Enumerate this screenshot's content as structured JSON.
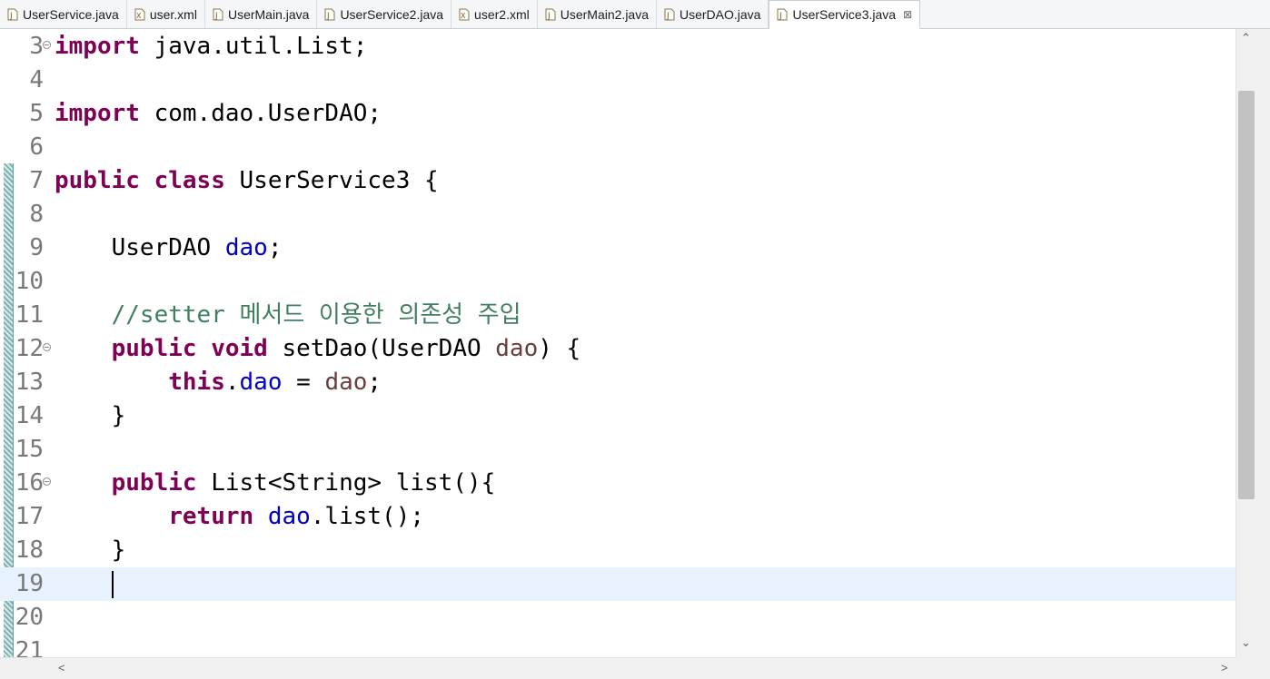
{
  "tabs": [
    {
      "label": "UserService.java",
      "type": "java",
      "active": false
    },
    {
      "label": "user.xml",
      "type": "xml",
      "active": false
    },
    {
      "label": "UserMain.java",
      "type": "java",
      "active": false
    },
    {
      "label": "UserService2.java",
      "type": "java",
      "active": false
    },
    {
      "label": "user2.xml",
      "type": "xml",
      "active": false
    },
    {
      "label": "UserMain2.java",
      "type": "java",
      "active": false
    },
    {
      "label": "UserDAO.java",
      "type": "java",
      "active": false
    },
    {
      "label": "UserService3.java",
      "type": "java",
      "active": true
    }
  ],
  "tab_close_glyph": "⊠",
  "editor": {
    "lines": [
      {
        "num": "3",
        "fold": true,
        "parts": [
          {
            "t": "import",
            "c": "kw"
          },
          {
            "t": " java.util.List;",
            "c": ""
          }
        ]
      },
      {
        "num": "4",
        "parts": []
      },
      {
        "num": "5",
        "parts": [
          {
            "t": "import",
            "c": "kw"
          },
          {
            "t": " com.dao.UserDAO;",
            "c": ""
          }
        ]
      },
      {
        "num": "6",
        "parts": []
      },
      {
        "num": "7",
        "parts": [
          {
            "t": "public",
            "c": "kw"
          },
          {
            "t": " ",
            "c": ""
          },
          {
            "t": "class",
            "c": "kw"
          },
          {
            "t": " UserService3 {",
            "c": ""
          }
        ]
      },
      {
        "num": "8",
        "parts": []
      },
      {
        "num": "9",
        "parts": [
          {
            "t": "    UserDAO ",
            "c": ""
          },
          {
            "t": "dao",
            "c": "fld"
          },
          {
            "t": ";",
            "c": ""
          }
        ]
      },
      {
        "num": "10",
        "parts": []
      },
      {
        "num": "11",
        "parts": [
          {
            "t": "    ",
            "c": ""
          },
          {
            "t": "//setter 메서드 이용한 의존성 주입",
            "c": "cmt"
          }
        ]
      },
      {
        "num": "12",
        "fold": true,
        "parts": [
          {
            "t": "    ",
            "c": ""
          },
          {
            "t": "public",
            "c": "kw"
          },
          {
            "t": " ",
            "c": ""
          },
          {
            "t": "void",
            "c": "kw"
          },
          {
            "t": " setDao(UserDAO ",
            "c": ""
          },
          {
            "t": "dao",
            "c": "param"
          },
          {
            "t": ") {",
            "c": ""
          }
        ]
      },
      {
        "num": "13",
        "parts": [
          {
            "t": "        ",
            "c": ""
          },
          {
            "t": "this",
            "c": "kw"
          },
          {
            "t": ".",
            "c": ""
          },
          {
            "t": "dao",
            "c": "fld"
          },
          {
            "t": " = ",
            "c": ""
          },
          {
            "t": "dao",
            "c": "param"
          },
          {
            "t": ";",
            "c": ""
          }
        ]
      },
      {
        "num": "14",
        "parts": [
          {
            "t": "    }",
            "c": ""
          }
        ]
      },
      {
        "num": "15",
        "parts": []
      },
      {
        "num": "16",
        "fold": true,
        "parts": [
          {
            "t": "    ",
            "c": ""
          },
          {
            "t": "public",
            "c": "kw"
          },
          {
            "t": " List<String> list(){",
            "c": ""
          }
        ]
      },
      {
        "num": "17",
        "parts": [
          {
            "t": "        ",
            "c": ""
          },
          {
            "t": "return",
            "c": "kw"
          },
          {
            "t": " ",
            "c": ""
          },
          {
            "t": "dao",
            "c": "fld"
          },
          {
            "t": ".list();",
            "c": ""
          }
        ]
      },
      {
        "num": "18",
        "parts": [
          {
            "t": "    }",
            "c": ""
          }
        ]
      },
      {
        "num": "19",
        "current": true,
        "parts": [
          {
            "t": "    ",
            "c": ""
          }
        ]
      },
      {
        "num": "20",
        "parts": []
      },
      {
        "num": "21",
        "parts": []
      }
    ],
    "colors": {
      "keyword": "#7f0055",
      "field": "#0000c0",
      "parameter": "#6a3e3e",
      "comment": "#3f7f5f",
      "current_line": "#e8f2fe"
    }
  },
  "scrollbar": {
    "up_glyph": "⌃",
    "down_glyph": "⌄",
    "left_glyph": "<",
    "right_glyph": ">"
  }
}
